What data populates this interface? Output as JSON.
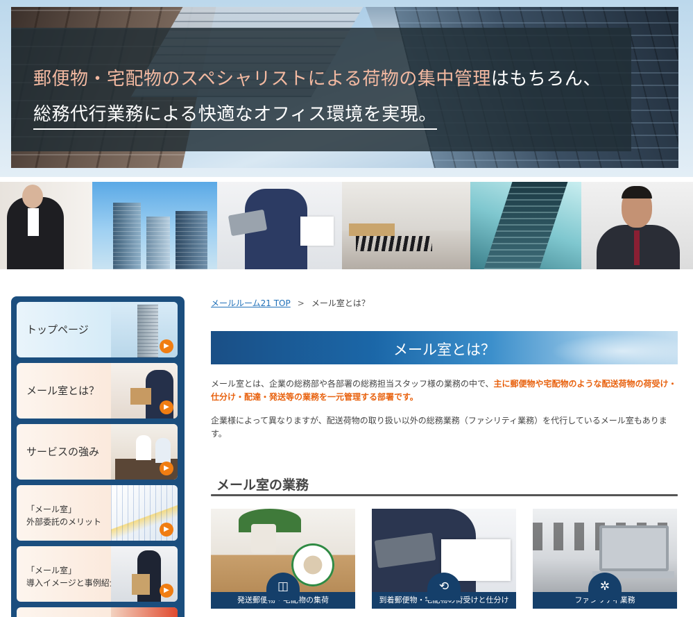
{
  "hero": {
    "line1_em": "郵便物・宅配物のスペシャリストによる荷物の集中管理",
    "line1_rest": "はもちろん、",
    "line2": "総務代行業務による快適なオフィス環境を実現。"
  },
  "sidebar": {
    "items": [
      {
        "label": "トップページ",
        "icon": "building-photo"
      },
      {
        "label": "メール室とは？",
        "icon": "delivery-photo"
      },
      {
        "label": "サービスの強み",
        "icon": "meeting-photo"
      },
      {
        "label_line1": "「メール室」",
        "label_line2": "外部委託のメリット",
        "icon": "chart-photo"
      },
      {
        "label_line1": "「メール室」",
        "label_line2": "導入イメージと事例紹介",
        "icon": "worker-photo"
      }
    ],
    "go_icon": "▶"
  },
  "breadcrumb": {
    "home": "メールルーム21 TOP",
    "separator": ">",
    "current": "メール室とは？"
  },
  "main": {
    "title": "メール室とは？",
    "para1_normal": "メール室とは、企業の総務部や各部署の総務担当スタッフ様の業務の中で、",
    "para1_highlight": "主に郵便物や宅配物のような配送荷物の荷受け・仕分け・配達・発送等の業務を一元管理する部署です。",
    "para2": "企業様によって異なりますが、配送荷物の取り扱い以外の総務業務（ファシリティ業務）を代行しているメール室もあります。",
    "section_heading": "メール室の業務",
    "cards": [
      {
        "label": "発送郵便物・宅配物の集荷",
        "icon": "box-icon",
        "glyph": "◫"
      },
      {
        "label": "到着郵便物・宅配物の荷受けと仕分け",
        "icon": "sort-arrows-icon",
        "glyph": "⟲"
      },
      {
        "label": "ファシリティ業務",
        "icon": "gear-icon",
        "glyph": "✲"
      }
    ]
  },
  "colors": {
    "sidebar_bg": "#1b4e7e",
    "accent_orange": "#e8620f",
    "card_bar": "#153f6a",
    "link": "#1e6fb8"
  }
}
